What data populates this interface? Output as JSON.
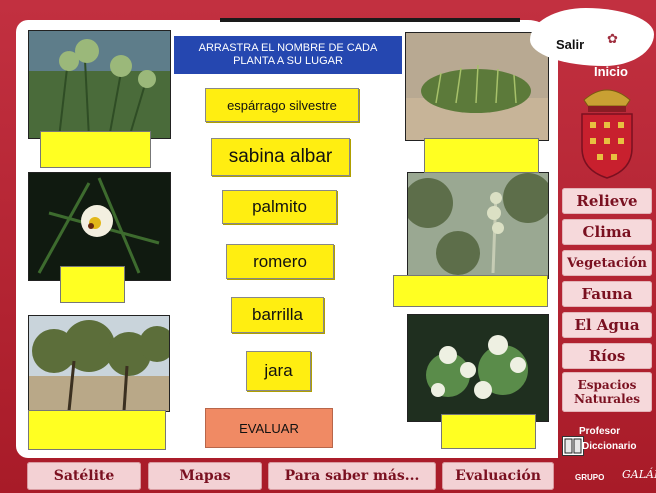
{
  "instruction": "ARRASTRA EL NOMBRE DE CADA PLANTA A SU LUGAR",
  "words": [
    "espárrago silvestre",
    "sabina albar",
    "palmito",
    "romero",
    "barrilla",
    "jara"
  ],
  "evaluate_label": "EVALUAR",
  "header": {
    "exit_label": "Salir",
    "home_label": "Inicio"
  },
  "side_nav": [
    {
      "label": "Relieve"
    },
    {
      "label": "Clima"
    },
    {
      "label": "Vegetación"
    },
    {
      "label": "Fauna"
    },
    {
      "label": "El Agua"
    },
    {
      "label": "Ríos"
    },
    {
      "label": "Espacios Naturales"
    }
  ],
  "teacher_label": "Profesor",
  "dictionary_label": "Diccionario",
  "bottom_nav": [
    {
      "label": "Satélite"
    },
    {
      "label": "Mapas"
    },
    {
      "label": "Para saber más..."
    },
    {
      "label": "Evaluación"
    }
  ],
  "credit": {
    "group": "GRUPO",
    "name": "GALÁN"
  },
  "colors": {
    "frame": "#b4202c",
    "slot": "#ffff22",
    "word": "#ffee11",
    "instruction_bg": "#2547b0",
    "evaluate": "#f08a64",
    "nav_bg": "#f6d9db"
  },
  "icons": {
    "exit": "flower-icon",
    "dictionary": "book-icon",
    "coat_of_arms": "coat-of-arms-icon"
  }
}
